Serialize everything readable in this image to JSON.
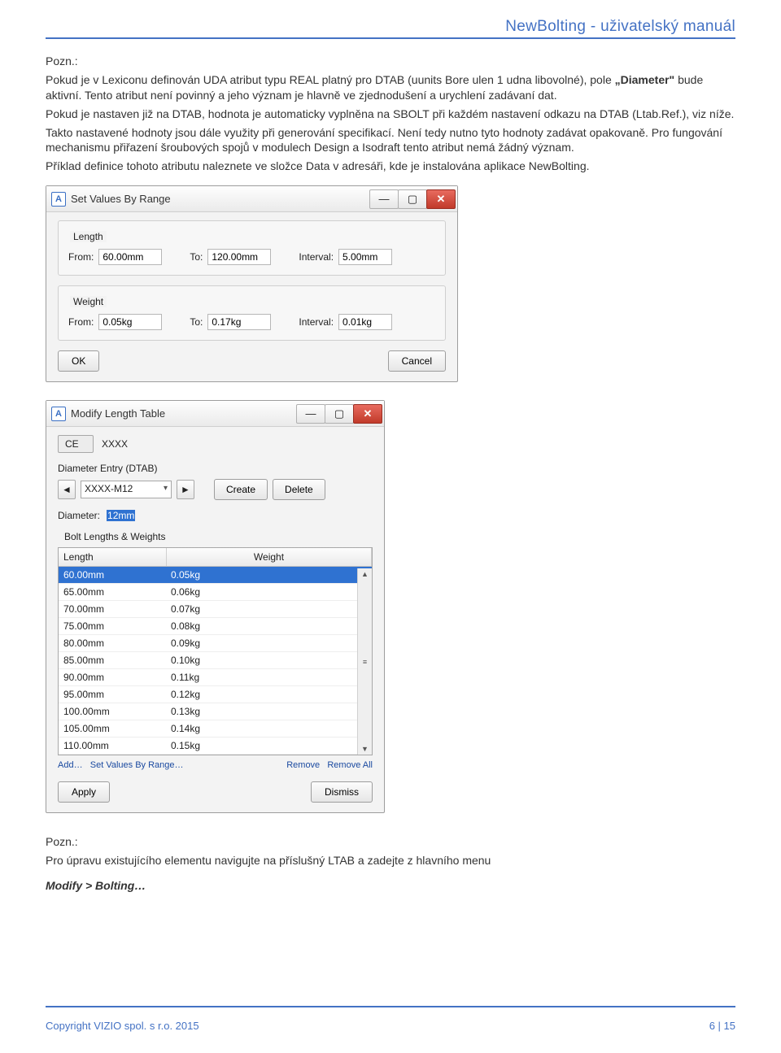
{
  "header": {
    "title": "NewBolting - uživatelský manuál"
  },
  "body": {
    "pozn_label": "Pozn.:",
    "p1a": "Pokud je v Lexiconu definován UDA atribut typu REAL platný pro DTAB (uunits Bore ulen 1 udna libovolné), pole ",
    "p1b_bold": "„Diameter\"",
    "p1c": " bude aktivní. Tento atribut není povinný a jeho význam je hlavně ve zjednodušení a urychlení zadávaní dat.",
    "p2": "Pokud je nastaven již na DTAB, hodnota je automaticky vyplněna na SBOLT při každém nastavení odkazu na DTAB (Ltab.Ref.), viz níže.",
    "p3": "Takto nastavené hodnoty jsou dále využity při generování specifikací. Není tedy nutno tyto hodnoty zadávat opakovaně. Pro fungování mechanismu přiřazení šroubových spojů v modulech Design a Isodraft tento atribut nemá žádný význam.",
    "p4": "Příklad definice tohoto atributu naleznete ve složce Data v adresáři, kde je instalována aplikace NewBolting.",
    "pozn2": "Pro úpravu existujícího elementu navigujte na příslušný LTAB a zadejte z hlavního menu",
    "modify_path": "Modify > Bolting…"
  },
  "ss1": {
    "title": "Set Values By Range",
    "group1": "Length",
    "group2": "Weight",
    "labels": {
      "from": "From:",
      "to": "To:",
      "interval": "Interval:"
    },
    "length": {
      "from": "60.00mm",
      "to": "120.00mm",
      "interval": "5.00mm"
    },
    "weight": {
      "from": "0.05kg",
      "to": "0.17kg",
      "interval": "0.01kg"
    },
    "ok": "OK",
    "cancel": "Cancel"
  },
  "ss2": {
    "title": "Modify Length Table",
    "ce": "CE",
    "ce_val": "XXXX",
    "dtab_label": "Diameter Entry (DTAB)",
    "dtab_val": "XXXX-M12",
    "create": "Create",
    "delete": "Delete",
    "diameter_label": "Diameter:",
    "diameter_val": "12mm",
    "bolt_label": "Bolt Lengths & Weights",
    "th_length": "Length",
    "th_weight": "Weight",
    "rows": [
      {
        "l": "60.00mm",
        "w": "0.05kg",
        "sel": true
      },
      {
        "l": "65.00mm",
        "w": "0.06kg"
      },
      {
        "l": "70.00mm",
        "w": "0.07kg"
      },
      {
        "l": "75.00mm",
        "w": "0.08kg"
      },
      {
        "l": "80.00mm",
        "w": "0.09kg"
      },
      {
        "l": "85.00mm",
        "w": "0.10kg"
      },
      {
        "l": "90.00mm",
        "w": "0.11kg"
      },
      {
        "l": "95.00mm",
        "w": "0.12kg"
      },
      {
        "l": "100.00mm",
        "w": "0.13kg"
      },
      {
        "l": "105.00mm",
        "w": "0.14kg"
      },
      {
        "l": "110.00mm",
        "w": "0.15kg"
      }
    ],
    "links": {
      "add": "Add…",
      "setvals": "Set Values By Range…",
      "remove": "Remove",
      "remove_all": "Remove All"
    },
    "apply": "Apply",
    "dismiss": "Dismiss"
  },
  "footer": {
    "copyright": "Copyright VIZIO spol. s r.o. 2015",
    "page": "6 | 15"
  }
}
